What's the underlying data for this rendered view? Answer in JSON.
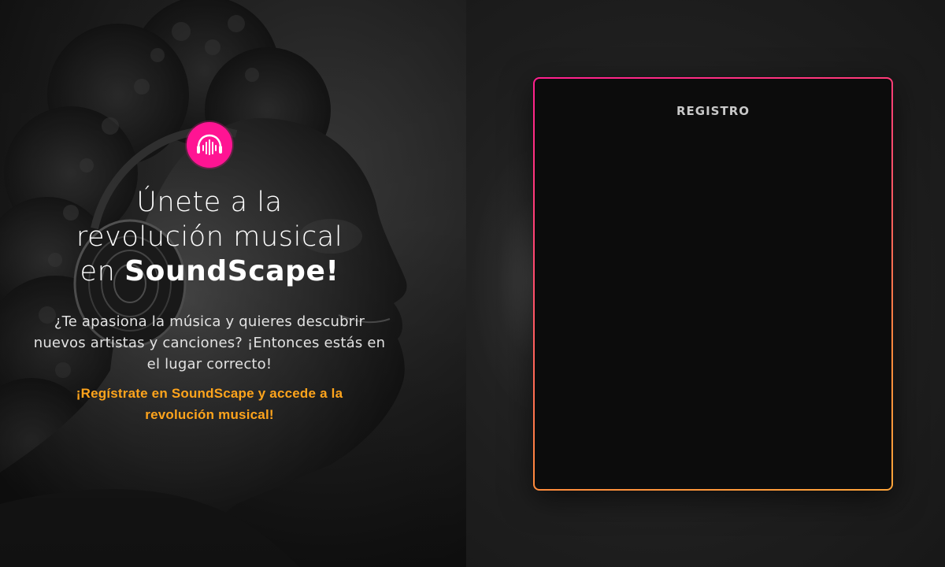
{
  "hero": {
    "logo_icon": "soundwave-headphones-icon",
    "title_line1": "Únete a la",
    "title_line2": "revolución musical",
    "title_line3_prefix": "en",
    "title_brand": "SoundScape!",
    "description": "¿Te apasiona la música y quieres descubrir nuevos artistas y canciones? ¡Entonces estás en el lugar correcto!",
    "cta": "¡Regístrate en SoundScape y accede a la revolución musical!"
  },
  "form_card": {
    "title": "REGISTRO"
  },
  "colors": {
    "accent_pink": "#ff1493",
    "accent_orange": "#ffa41c",
    "background": "#161616"
  }
}
